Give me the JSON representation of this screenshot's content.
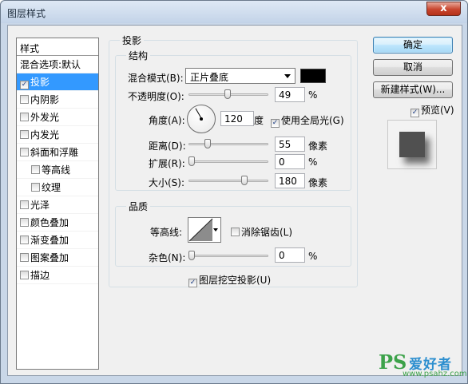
{
  "window": {
    "title": "图层样式",
    "close_glyph": "x"
  },
  "styles_panel": {
    "header": "样式",
    "items": [
      {
        "label": "混合选项:默认",
        "checkbox": false,
        "checked": false,
        "indent": false,
        "selected": false
      },
      {
        "label": "投影",
        "checkbox": true,
        "checked": true,
        "indent": false,
        "selected": true
      },
      {
        "label": "内阴影",
        "checkbox": true,
        "checked": false,
        "indent": false,
        "selected": false
      },
      {
        "label": "外发光",
        "checkbox": true,
        "checked": false,
        "indent": false,
        "selected": false
      },
      {
        "label": "内发光",
        "checkbox": true,
        "checked": false,
        "indent": false,
        "selected": false
      },
      {
        "label": "斜面和浮雕",
        "checkbox": true,
        "checked": false,
        "indent": false,
        "selected": false
      },
      {
        "label": "等高线",
        "checkbox": true,
        "checked": false,
        "indent": true,
        "selected": false
      },
      {
        "label": "纹理",
        "checkbox": true,
        "checked": false,
        "indent": true,
        "selected": false
      },
      {
        "label": "光泽",
        "checkbox": true,
        "checked": false,
        "indent": false,
        "selected": false
      },
      {
        "label": "颜色叠加",
        "checkbox": true,
        "checked": false,
        "indent": false,
        "selected": false
      },
      {
        "label": "渐变叠加",
        "checkbox": true,
        "checked": false,
        "indent": false,
        "selected": false
      },
      {
        "label": "图案叠加",
        "checkbox": true,
        "checked": false,
        "indent": false,
        "selected": false
      },
      {
        "label": "描边",
        "checkbox": true,
        "checked": false,
        "indent": false,
        "selected": false
      }
    ]
  },
  "drop_shadow": {
    "section_title": "投影",
    "structure": {
      "title": "结构",
      "blend_mode_label": "混合模式(B):",
      "blend_mode_value": "正片叠底",
      "shadow_color": "#000000",
      "opacity_label": "不透明度(O):",
      "opacity_value": "49",
      "opacity_unit": "%",
      "opacity_level": 0.49,
      "angle_label": "角度(A):",
      "angle_value": "120",
      "angle_unit": "度",
      "angle_degrees": 120,
      "global_light_label": "使用全局光(G)",
      "global_light_checked": true,
      "distance_label": "距离(D):",
      "distance_value": "55",
      "distance_unit": "像素",
      "distance_level": 0.22,
      "spread_label": "扩展(R):",
      "spread_value": "0",
      "spread_unit": "%",
      "spread_level": 0,
      "size_label": "大小(S):",
      "size_value": "180",
      "size_unit": "像素",
      "size_level": 0.72
    },
    "quality": {
      "title": "品质",
      "contour_label": "等高线:",
      "anti_alias_label": "消除锯齿(L)",
      "anti_alias_checked": false,
      "noise_label": "杂色(N):",
      "noise_value": "0",
      "noise_unit": "%",
      "noise_level": 0
    },
    "knockout_label": "图层挖空投影(U)",
    "knockout_checked": true
  },
  "buttons": {
    "ok": "确定",
    "cancel": "取消",
    "new_style": "新建样式(W)...",
    "preview_label": "预览(V)",
    "preview_checked": true
  },
  "watermark": {
    "ps": "PS",
    "text": "爱好者",
    "url": "www.psahz.com"
  }
}
